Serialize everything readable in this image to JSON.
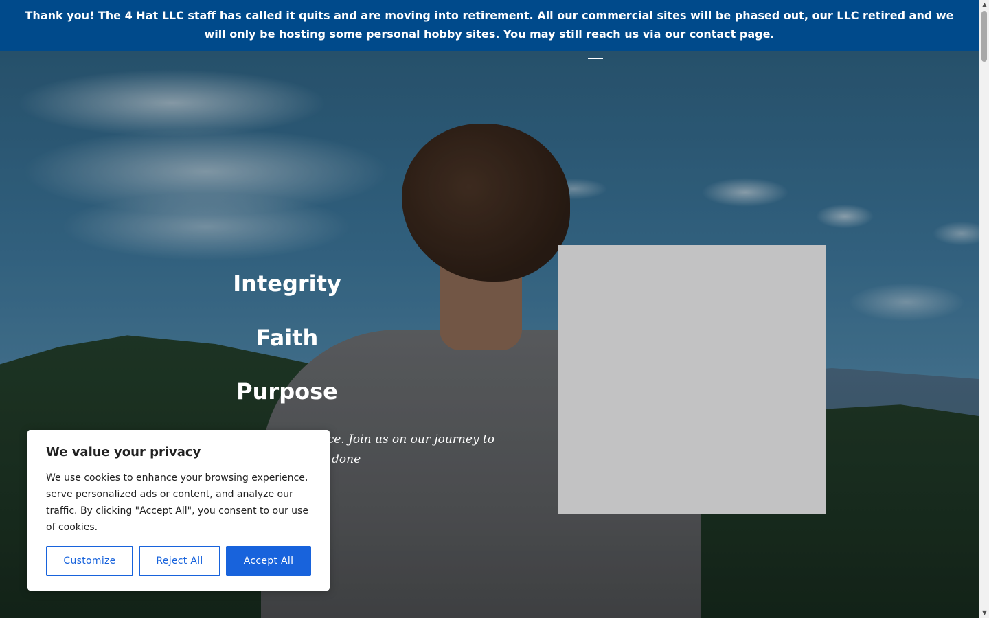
{
  "banner": {
    "text": "Thank you! The 4 Hat LLC staff has called it quits and are moving into retirement. All our commercial sites will be phased out, our LLC retired and we will only be hosting some personal hobby sites. You may still reach us via our contact page.",
    "background_color": "#004a8b"
  },
  "hero": {
    "values": [
      "Integrity",
      "Faith",
      "Purpose"
    ],
    "tagline_line1": "ace.  Join us on our journey to",
    "tagline_line2": "done"
  },
  "cookie_consent": {
    "title": "We value your privacy",
    "body": "We use cookies to enhance your browsing experience, serve personalized ads or content, and analyze our traffic. By clicking \"Accept All\", you consent to our use of cookies.",
    "customize_label": "Customize",
    "reject_label": "Reject All",
    "accept_label": "Accept All",
    "accent_color": "#1863dc"
  }
}
